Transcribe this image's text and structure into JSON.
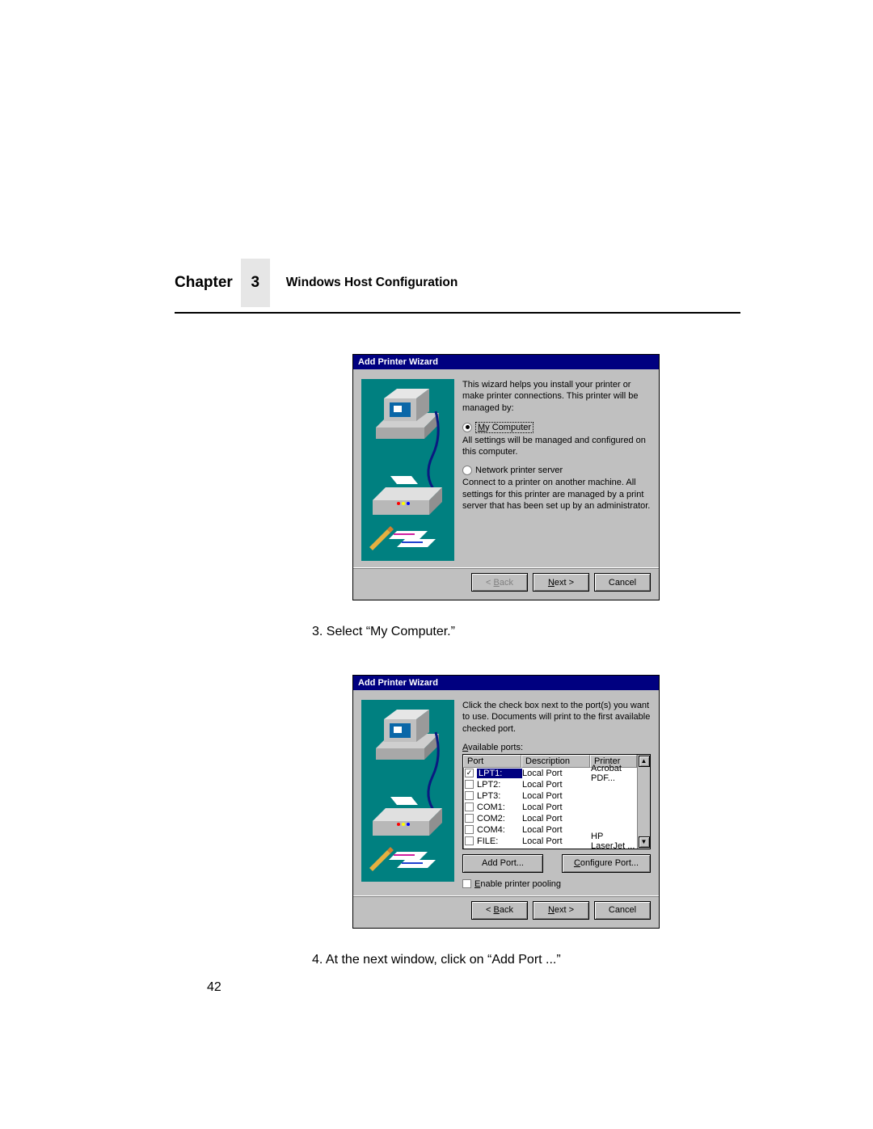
{
  "header": {
    "chapter_label": "Chapter",
    "chapter_number": "3",
    "chapter_title": "Windows Host Configuration"
  },
  "dialog1": {
    "title": "Add Printer Wizard",
    "intro": "This wizard helps you install your printer or make printer connections.  This printer will be managed by:",
    "radio1_label": "My Computer",
    "radio1_desc": "All settings will be managed and configured on this computer.",
    "radio2_label": "Network printer server",
    "radio2_desc": "Connect to a printer on another machine.  All settings for this printer are managed by a print server that has been set up by an administrator.",
    "back": "< Back",
    "next": "Next >",
    "cancel": "Cancel"
  },
  "step3": "3.   Select “My Computer.”",
  "dialog2": {
    "title": "Add Printer Wizard",
    "intro": "Click the check box next to the port(s) you want to use. Documents will print to the first available checked port.",
    "ports_label": "Available ports:",
    "headers": {
      "port": "Port",
      "desc": "Description",
      "printer": "Printer"
    },
    "rows": [
      {
        "checked": true,
        "selected": true,
        "port": "LPT1:",
        "desc": "Local Port",
        "printer": "Acrobat PDF..."
      },
      {
        "checked": false,
        "selected": false,
        "port": "LPT2:",
        "desc": "Local Port",
        "printer": ""
      },
      {
        "checked": false,
        "selected": false,
        "port": "LPT3:",
        "desc": "Local Port",
        "printer": ""
      },
      {
        "checked": false,
        "selected": false,
        "port": "COM1:",
        "desc": "Local Port",
        "printer": ""
      },
      {
        "checked": false,
        "selected": false,
        "port": "COM2:",
        "desc": "Local Port",
        "printer": ""
      },
      {
        "checked": false,
        "selected": false,
        "port": "COM4:",
        "desc": "Local Port",
        "printer": ""
      },
      {
        "checked": false,
        "selected": false,
        "port": "FILE:",
        "desc": "Local Port",
        "printer": "HP LaserJet ..."
      }
    ],
    "add_port": "Add Port...",
    "configure_port": "Configure Port...",
    "enable_pooling": "Enable printer pooling",
    "back": "< Back",
    "next": "Next >",
    "cancel": "Cancel"
  },
  "step4": "4.   At the next window, click on “Add Port ...”",
  "page_number": "42"
}
